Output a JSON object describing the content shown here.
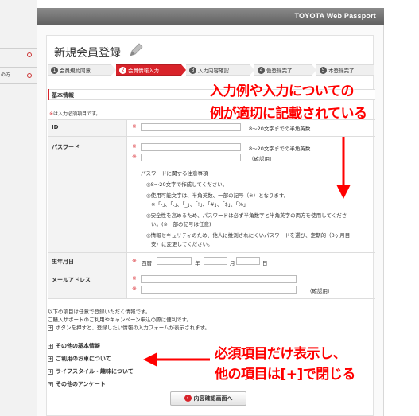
{
  "header": {
    "title": "TOYOTA Web Passport"
  },
  "left_panel": {
    "items": [
      "の方"
    ]
  },
  "page_title": "新規会員登録",
  "steps": [
    {
      "num": "1",
      "label": "会員規約同意",
      "active": false
    },
    {
      "num": "2",
      "label": "会員情報入力",
      "active": true
    },
    {
      "num": "3",
      "label": "入力内容確認",
      "active": false
    },
    {
      "num": "4",
      "label": "仮登録完了",
      "active": false
    },
    {
      "num": "5",
      "label": "本登録完了",
      "active": false
    }
  ],
  "section": {
    "title": "基本情報",
    "required_note_mark": "※",
    "required_note": "は入力必須項目です。"
  },
  "form": {
    "req_mark": "※",
    "id": {
      "label": "ID",
      "hint": "8〜20文字までの半角英数"
    },
    "password": {
      "label": "パスワード",
      "hint": "8〜20文字までの半角英数",
      "confirm_hint": "（確認用）",
      "notes_title": "パスワードに関する注意事項",
      "notes": [
        "◎8〜20文字で作成してください。",
        "◎使用可能文字は、半角英数、一部の記号（※）となります。",
        "※「-」、「.」、「_」、「!」、「#」、「$」、「%」",
        "◎安全性を高めるため、パスワードは必ず半角数字と半角英字の両方を使用してくださ",
        "い。(※一部の記号は任意)",
        "◎情報セキュリティのため、他人に推測されにくいパスワードを選び、定期的（3ヶ月目",
        "安）に変更してください。"
      ]
    },
    "birthday": {
      "label": "生年月日",
      "era": "西暦",
      "year": "年",
      "month": "月",
      "day": "日"
    },
    "email": {
      "label": "メールアドレス",
      "confirm_hint": "（確認用）"
    }
  },
  "optional": {
    "lines": [
      "以下の項目は任意で登録いただく情報です。",
      "ご購入サポートのご利用やキャンペーン申込の際に便利です。",
      "ボタンを押すと、登録したい情報の入力フォームが表示されます。"
    ],
    "items": [
      "その他の基本情報",
      "ご利用のお車について",
      "ライフスタイル・趣味について",
      "その他のアンケート"
    ]
  },
  "confirm_button": "内容確認画面へ",
  "annotations": {
    "top_line1": "入力例や入力についての",
    "top_line2": "例が適切に記載されている",
    "bottom_line1": "必須項目だけ表示し、",
    "bottom_line2": "他の項目は[+]で閉じる"
  },
  "colors": {
    "accent": "#d8232a",
    "annotation": "#ff0000"
  }
}
